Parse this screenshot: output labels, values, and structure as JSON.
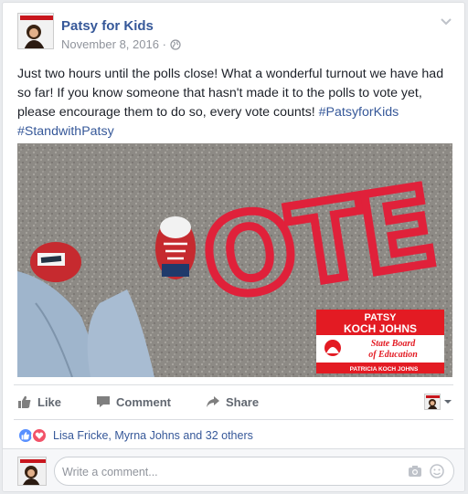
{
  "post": {
    "page_name": "Patsy for Kids",
    "date": "November 8, 2016 ·",
    "text_main": "Just two hours until the polls close! What a wonderful turnout we have had so far! If you know someone that hasn't made it to the polls to vote yet, please encourage them to do so, every vote counts! ",
    "hashtag_1": "#PatsyforKids",
    "hashtag_2": "#StandwithPatsy",
    "icons": {
      "privacy": "globe-icon",
      "options": "chevron-down-icon"
    }
  },
  "image": {
    "chalk_text": "OTE",
    "logo": {
      "name_line_1": "PATSY",
      "name_line_2": "KOCH JOHNS",
      "subtitle_1": "State Board",
      "subtitle_2": "of Education",
      "footer": "PATRICIA KOCH JOHNS"
    }
  },
  "actions": {
    "like_label": "Like",
    "comment_label": "Comment",
    "share_label": "Share"
  },
  "reactions": {
    "summary": "Lisa Fricke, Myrna Johns and 32 others"
  },
  "comment": {
    "placeholder": "Write a comment..."
  },
  "colors": {
    "link": "#365899",
    "brand_red": "#e31b23",
    "like_blue": "#5890ff",
    "love_red": "#f25268"
  }
}
